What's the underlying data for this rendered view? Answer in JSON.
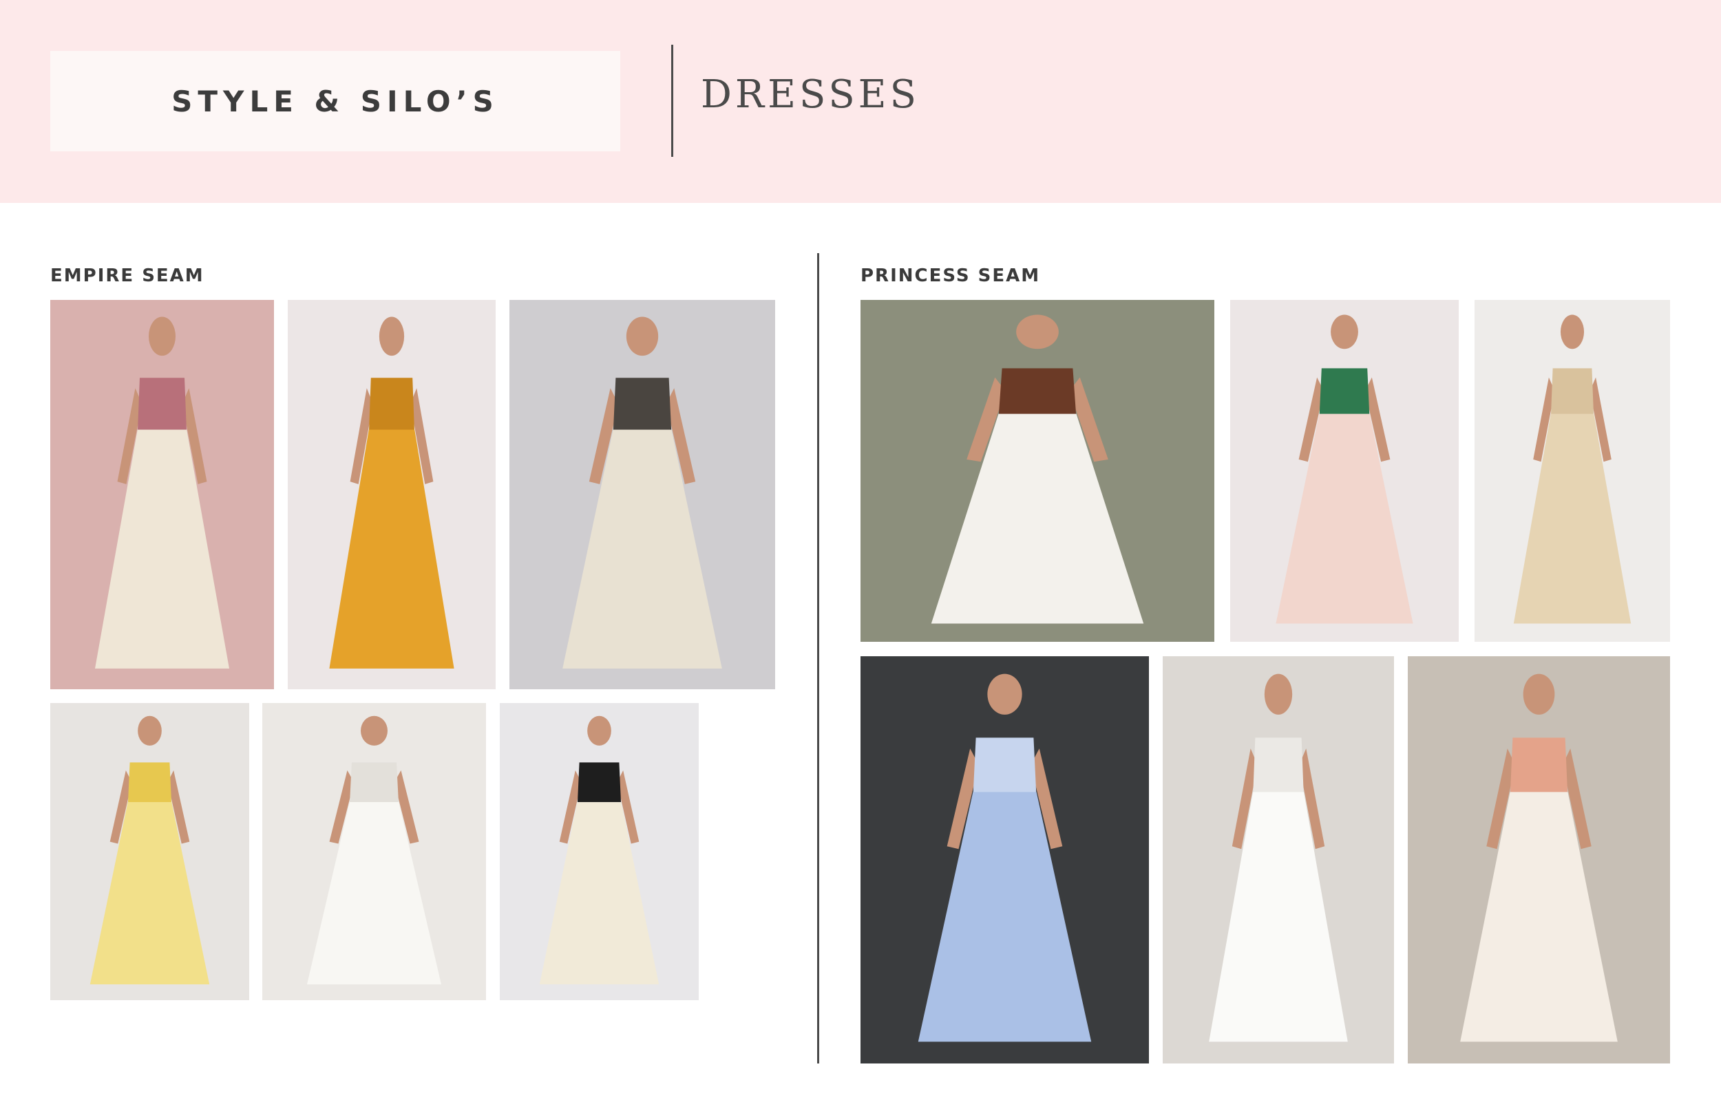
{
  "header": {
    "brand": "STYLE & SILO’S",
    "category": "DRESSES",
    "background_color": "#fde9ea"
  },
  "sections": [
    {
      "label": "EMPIRE SEAM",
      "photos": [
        {
          "dress_color": "#efe6d6",
          "accent": "#b8707a",
          "bg": "#d9b1ae"
        },
        {
          "dress_color": "#e5a22a",
          "accent": "#c9861c",
          "bg": "#ece6e6"
        },
        {
          "dress_color": "#e8e1d2",
          "accent": "#4a4540",
          "bg": "#cfcdd0"
        },
        {
          "dress_color": "#f2e08a",
          "accent": "#e7c84f",
          "bg": "#e7e4e1"
        },
        {
          "dress_color": "#f8f7f3",
          "accent": "#e3e0da",
          "bg": "#ebe8e4"
        },
        {
          "dress_color": "#f1ead8",
          "accent": "#1e1e1e",
          "bg": "#e8e7e9"
        }
      ]
    },
    {
      "label": "PRINCESS SEAM",
      "photos": [
        {
          "dress_color": "#f3f1ec",
          "accent": "#6b3a26",
          "bg": "#8c8f7c"
        },
        {
          "dress_color": "#f2d6cd",
          "accent": "#2f7a4f",
          "bg": "#ece6e6"
        },
        {
          "dress_color": "#e6d4b3",
          "accent": "#d9c29d",
          "bg": "#eeecea"
        },
        {
          "dress_color": "#aac0e6",
          "accent": "#c7d5ee",
          "bg": "#3a3c3e"
        },
        {
          "dress_color": "#fafaf8",
          "accent": "#ebe9e5",
          "bg": "#dcd8d3"
        },
        {
          "dress_color": "#f4ede4",
          "accent": "#e4a38a",
          "bg": "#c7bfb5"
        }
      ]
    }
  ]
}
